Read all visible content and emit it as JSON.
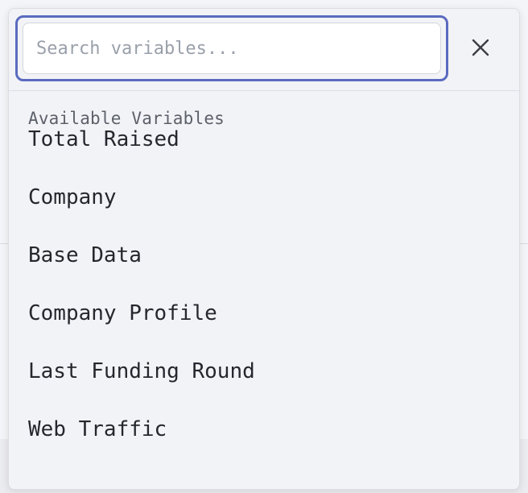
{
  "search": {
    "placeholder": "Search variables...",
    "value": ""
  },
  "close": {
    "icon": "close-icon"
  },
  "section": {
    "label": "Available Variables"
  },
  "variables": [
    {
      "label": "Total Raised"
    },
    {
      "label": "Company"
    },
    {
      "label": "Base Data"
    },
    {
      "label": "Company Profile"
    },
    {
      "label": "Last Funding Round"
    },
    {
      "label": "Web Traffic"
    }
  ],
  "colors": {
    "accent": "#5b6bbf",
    "panel_bg": "#f2f3f7",
    "text": "#24272d",
    "muted": "#5c6069"
  }
}
